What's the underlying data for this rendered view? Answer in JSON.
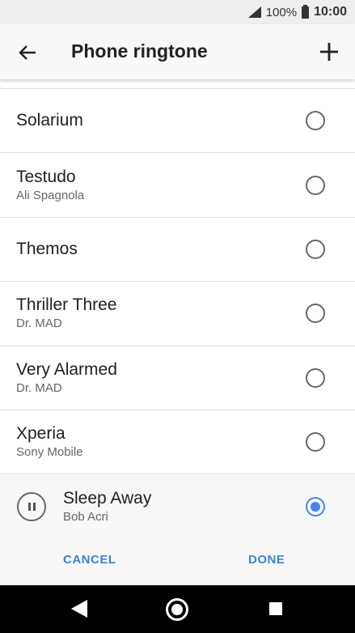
{
  "status_bar": {
    "battery_percent": "100%",
    "time": "10:00",
    "icons": [
      "signal-icon",
      "battery-icon"
    ]
  },
  "app_bar": {
    "title": "Phone ringtone",
    "back_icon": "arrow-left-icon",
    "add_icon": "plus-icon"
  },
  "ringtones": [
    {
      "title": "Solarium",
      "subtitle": ""
    },
    {
      "title": "Testudo",
      "subtitle": "Ali Spagnola"
    },
    {
      "title": "Themos",
      "subtitle": ""
    },
    {
      "title": "Thriller Three",
      "subtitle": "Dr. MAD"
    },
    {
      "title": "Very Alarmed",
      "subtitle": "Dr. MAD"
    },
    {
      "title": "Xperia",
      "subtitle": "Sony Mobile"
    }
  ],
  "selected": {
    "title": "Sleep Away",
    "subtitle": "Bob Acri",
    "play_icon": "pause-icon"
  },
  "actions": {
    "cancel_label": "CANCEL",
    "done_label": "DONE"
  },
  "colors": {
    "accent": "#4285f4",
    "button_text": "#3a86d4"
  },
  "nav_bar": {
    "icons": [
      "nav-back-icon",
      "nav-home-icon",
      "nav-recents-icon"
    ]
  }
}
